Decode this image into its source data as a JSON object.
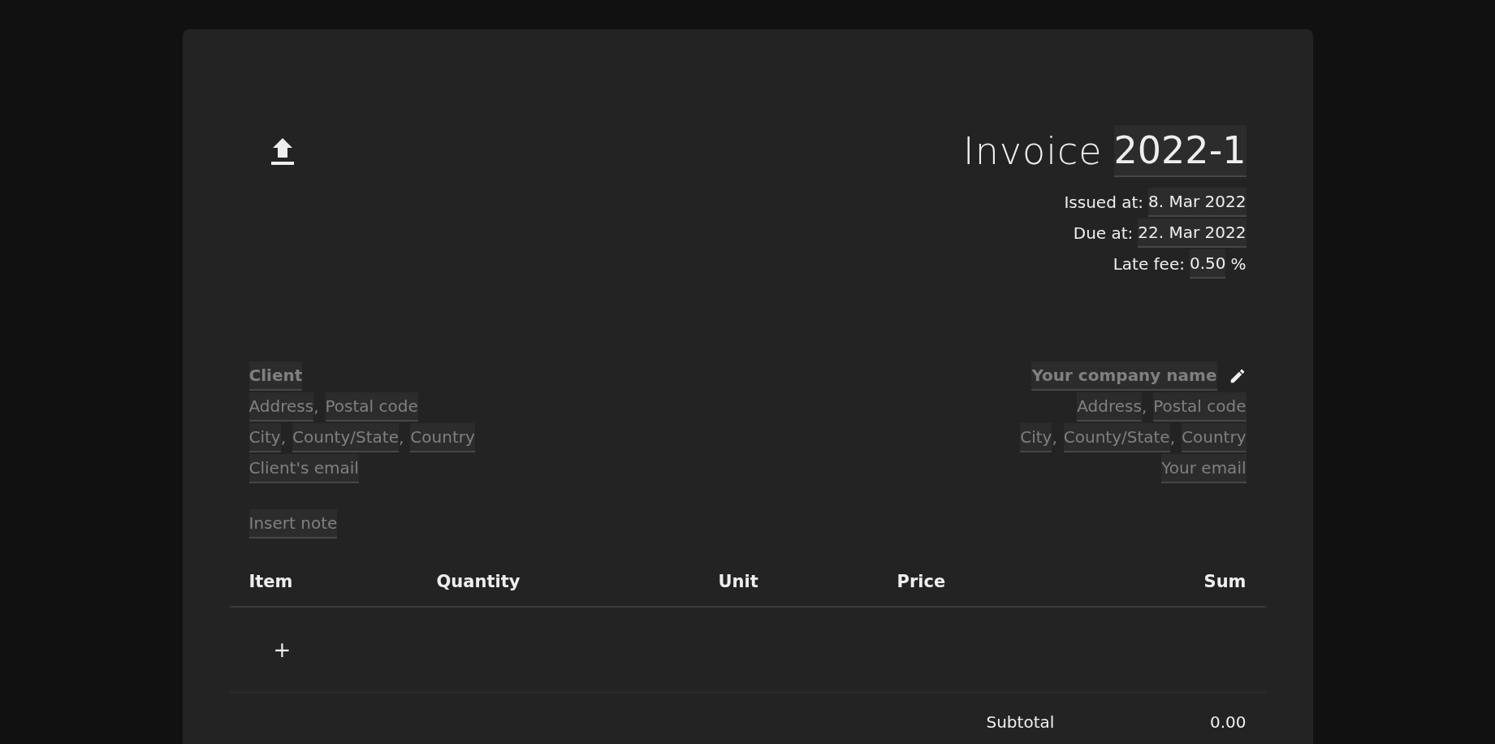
{
  "header": {
    "title": "Invoice",
    "number": {
      "value": "2022-1"
    },
    "meta": [
      {
        "label": "Issued at:",
        "value": "8. Mar 2022"
      },
      {
        "label": "Due at:",
        "value": "22. Mar 2022"
      },
      {
        "label": "Late fee:",
        "value": "0.50",
        "suffix": "%"
      }
    ]
  },
  "client": {
    "name": {
      "placeholder": "Client"
    },
    "lines": [
      [
        {
          "kind": "field",
          "placeholder": "Address"
        },
        {
          "kind": "text",
          "text": ","
        },
        {
          "kind": "field",
          "placeholder": "Postal code"
        }
      ],
      [
        {
          "kind": "field",
          "placeholder": "City"
        },
        {
          "kind": "text",
          "text": ","
        },
        {
          "kind": "field",
          "placeholder": "County/State"
        },
        {
          "kind": "text",
          "text": ","
        },
        {
          "kind": "field",
          "placeholder": "Country"
        }
      ],
      [
        {
          "kind": "field",
          "placeholder": "Client's email"
        }
      ]
    ]
  },
  "company": {
    "name": {
      "placeholder": "Your company name"
    },
    "lines": [
      [
        {
          "kind": "field",
          "placeholder": "Address"
        },
        {
          "kind": "text",
          "text": ","
        },
        {
          "kind": "field",
          "placeholder": "Postal code"
        }
      ],
      [
        {
          "kind": "field",
          "placeholder": "City"
        },
        {
          "kind": "text",
          "text": ","
        },
        {
          "kind": "field",
          "placeholder": "County/State"
        },
        {
          "kind": "text",
          "text": ","
        },
        {
          "kind": "field",
          "placeholder": "Country"
        }
      ],
      [
        {
          "kind": "field",
          "placeholder": "Your email"
        }
      ]
    ]
  },
  "note": {
    "placeholder": "Insert note"
  },
  "table": {
    "columns": [
      "Item",
      "Quantity",
      "Unit",
      "Price",
      "Sum"
    ],
    "add_button": "+"
  },
  "totals": [
    {
      "label": "Subtotal",
      "value": "0.00"
    }
  ]
}
